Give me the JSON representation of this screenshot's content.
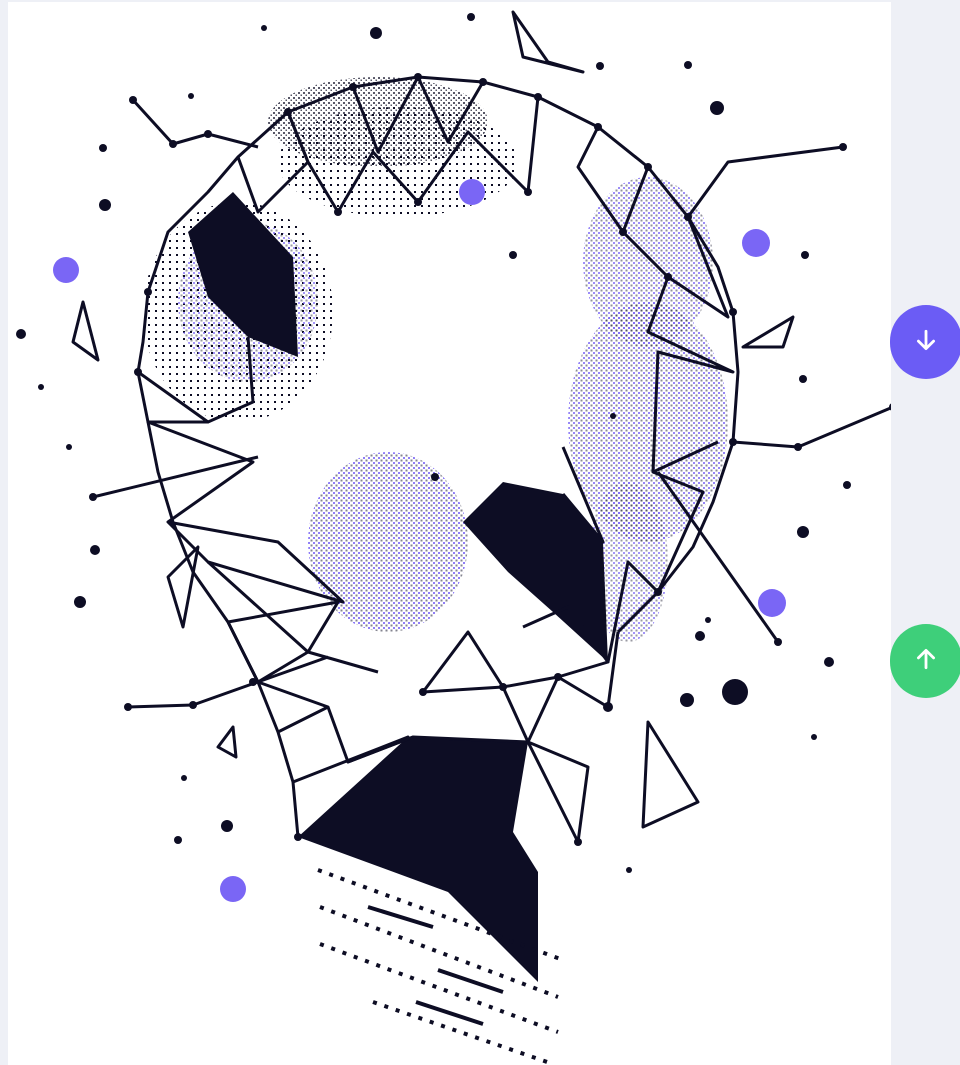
{
  "artwork": {
    "name": "lightbulb-polygon-illustration",
    "colors": {
      "ink": "#0d0d24",
      "accent": "#7a66f5",
      "background": "#ffffff",
      "page": "#eef0f6"
    }
  },
  "nav": {
    "scroll_down": {
      "icon": "arrow-down-icon",
      "color": "#6b5cf5"
    },
    "scroll_up": {
      "icon": "arrow-up-icon",
      "color": "#3ecf7a"
    }
  }
}
